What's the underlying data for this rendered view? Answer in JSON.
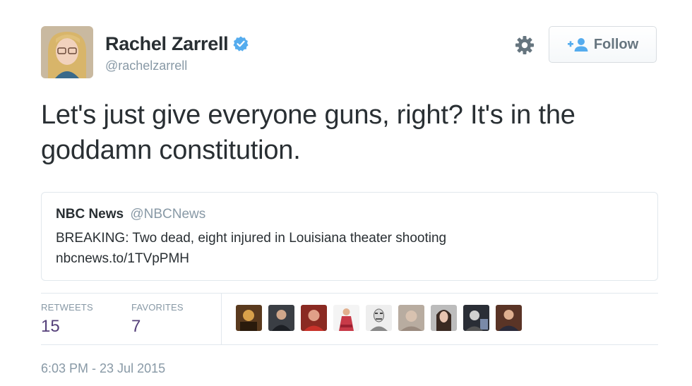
{
  "author": {
    "name": "Rachel Zarrell",
    "handle": "@rachelzarrell",
    "verified_icon": "verified-badge-icon",
    "verified_color": "#55acee"
  },
  "actions": {
    "settings_icon": "gear-icon",
    "follow_icon": "add-user-icon",
    "follow_label": "Follow"
  },
  "tweet": {
    "text": "Let's just give everyone guns, right? It's in the goddamn constitution."
  },
  "quoted_tweet": {
    "name": "NBC News",
    "handle": "@NBCNews",
    "text": "BREAKING: Two dead, eight injured in Louisiana theater shooting",
    "link": "nbcnews.to/1TVpPMH"
  },
  "stats": {
    "retweets_label": "RETWEETS",
    "retweets_count": "15",
    "favorites_label": "FAVORITES",
    "favorites_count": "7"
  },
  "favoriters_shown": 9,
  "timestamp": "6:03 PM - 23 Jul 2015",
  "colors": {
    "text": "#292f33",
    "muted": "#8899a6",
    "stat_value": "#55407a",
    "border": "#e1e8ed"
  }
}
